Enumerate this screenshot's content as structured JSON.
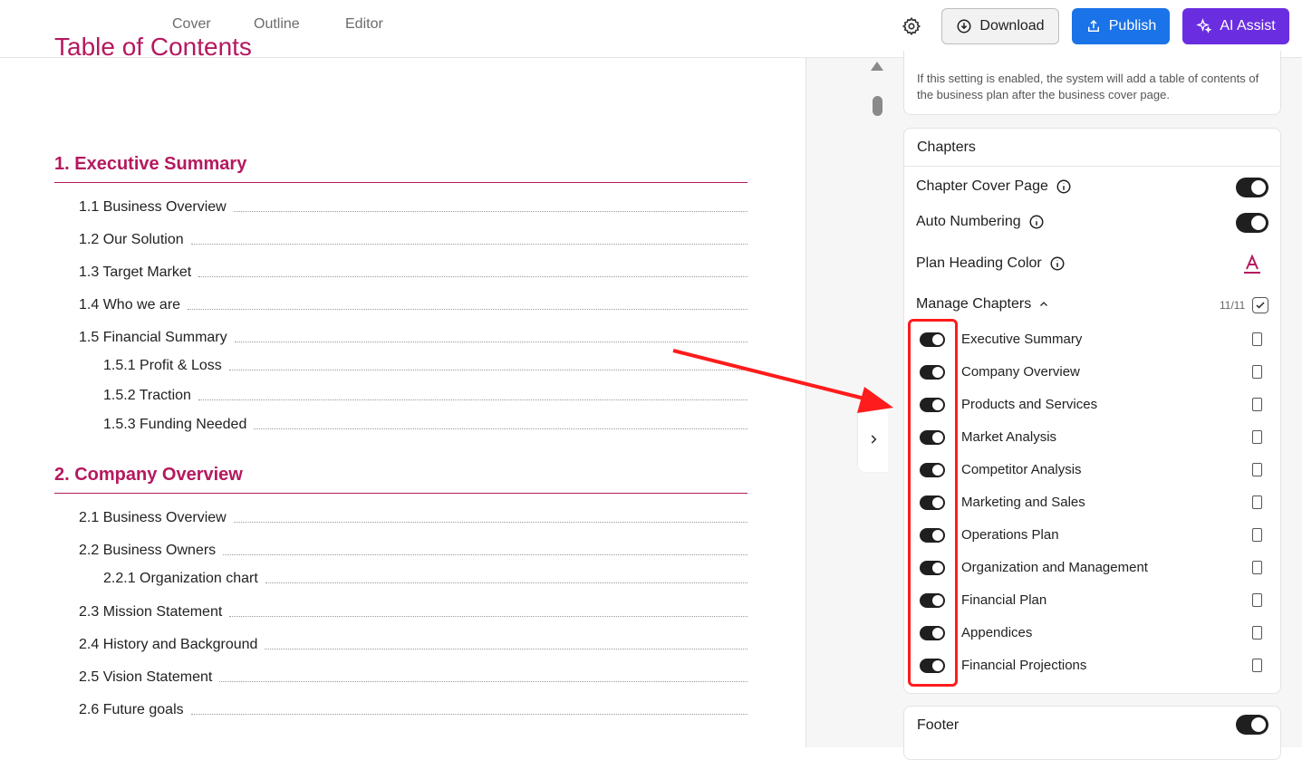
{
  "nav": {
    "tabs": [
      "Cover",
      "Outline",
      "Editor"
    ]
  },
  "toolbar": {
    "download_label": "Download",
    "publish_label": "Publish",
    "ai_label": "AI Assist"
  },
  "doc": {
    "title": "Table of Contents",
    "sections": [
      {
        "heading": "1. Executive Summary",
        "items": [
          {
            "label": "1.1 Business Overview",
            "level": 1
          },
          {
            "label": "1.2 Our Solution",
            "level": 1
          },
          {
            "label": "1.3 Target Market",
            "level": 1
          },
          {
            "label": "1.4 Who we are",
            "level": 1
          },
          {
            "label": "1.5 Financial Summary",
            "level": 1
          },
          {
            "label": "1.5.1 Profit & Loss",
            "level": 2
          },
          {
            "label": "1.5.2 Traction",
            "level": 2
          },
          {
            "label": "1.5.3 Funding Needed",
            "level": 2
          }
        ]
      },
      {
        "heading": "2. Company Overview",
        "items": [
          {
            "label": "2.1 Business Overview",
            "level": 1
          },
          {
            "label": "2.2 Business Owners",
            "level": 1
          },
          {
            "label": "2.2.1 Organization chart",
            "level": 2
          },
          {
            "label": "2.3 Mission Statement",
            "level": 1
          },
          {
            "label": "2.4 History and Background",
            "level": 1
          },
          {
            "label": "2.5 Vision Statement",
            "level": 1
          },
          {
            "label": "2.6 Future goals",
            "level": 1
          }
        ]
      }
    ]
  },
  "panel": {
    "toc_description": "If this setting is enabled, the system will add a table of contents of the business plan after the business cover page.",
    "chapters_title": "Chapters",
    "chapter_cover_label": "Chapter Cover Page",
    "auto_numbering_label": "Auto Numbering",
    "heading_color_label": "Plan Heading Color",
    "heading_color": "#b5195f",
    "manage_label": "Manage Chapters",
    "chapter_count": "11/11",
    "chapters": [
      "Executive Summary",
      "Company Overview",
      "Products and Services",
      "Market Analysis",
      "Competitor Analysis",
      "Marketing and Sales",
      "Operations Plan",
      "Organization and Management",
      "Financial Plan",
      "Appendices",
      "Financial Projections"
    ],
    "footer_label": "Footer"
  },
  "colors": {
    "accent": "#b5195f",
    "publish": "#1a73e8",
    "ai": "#6a2ee0",
    "annotation": "#ff1c1c"
  }
}
